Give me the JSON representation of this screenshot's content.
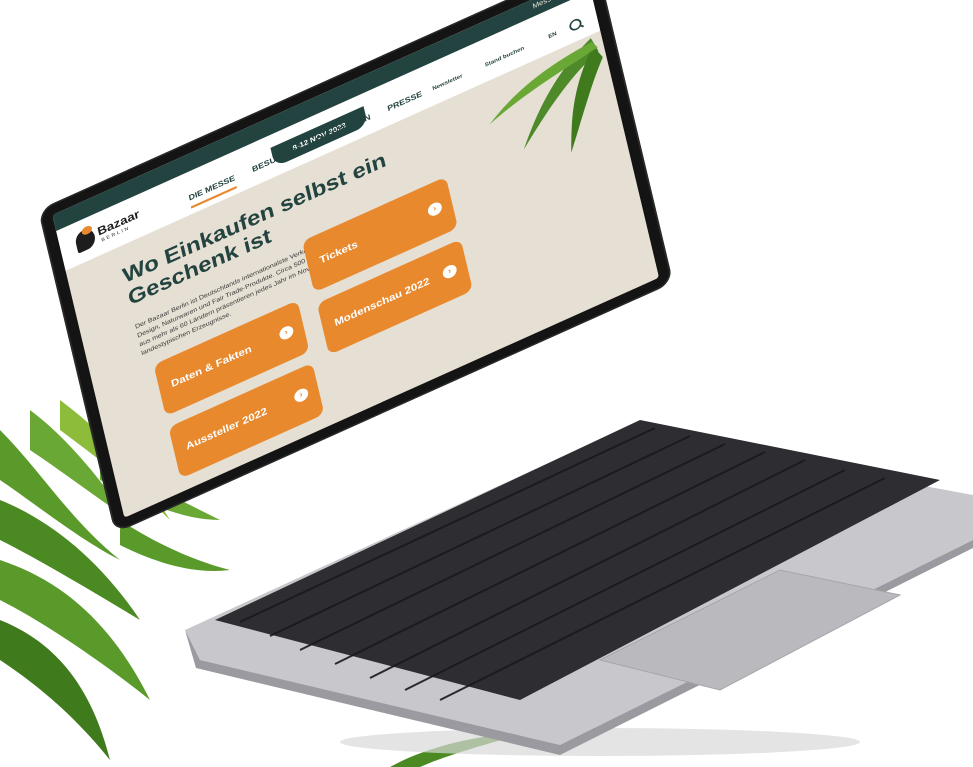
{
  "site": {
    "top_link": "Messe Berlin",
    "date_tab": "8-12 NOV 2023",
    "logo_word": "Bazaar",
    "logo_sub": "BERLIN",
    "nav": [
      "DIE MESSE",
      "BESUCHEN",
      "AUSSTELLEN",
      "PRESSE"
    ],
    "utility": [
      "Newsletter",
      "Stand buchen",
      "EN"
    ],
    "headline": "Wo Einkaufen selbst ein Geschenk ist",
    "intro": "Der Bazaar Berlin ist Deutschlands internationalste Verkaufsmesse für Kunsthandwerk, Design, Naturwaren und Fair Trade-Produkte. Circa 500 Hersteller*innen und Händler*innen aus mehr als 60 Ländern präsentieren jedes Jahr im November ihre einzigartigen Waren und landestypischen Erzeugnisse.",
    "cards": [
      "Daten & Fakten",
      "Tickets",
      "Aussteller 2022",
      "Modenschau 2022"
    ],
    "card_arrow": "›"
  },
  "colors": {
    "accent": "#e8892e",
    "brand_dark": "#22433f",
    "page_bg": "#e6dfd3"
  }
}
